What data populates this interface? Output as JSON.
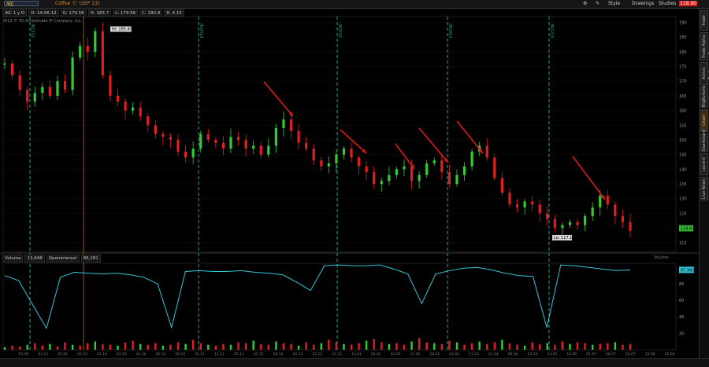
{
  "toolbar": {
    "symbol": "/KC",
    "description": "Coffee 'C' (SEP 13)",
    "style_label": "Style",
    "drawings_label": "Drawings",
    "studies_label": "Studies",
    "price_badge": "118.90"
  },
  "info": {
    "symbol_interval": "/KC 1 y D",
    "date": "D: 14.06.12",
    "open": "O: 179.56",
    "high": "H: 183.7",
    "low": "L: 179.56",
    "close": "C: 180.9",
    "change": "R: 4.15"
  },
  "copyright": "2013 © TD Ameritrade IP Company, Inc.",
  "right_tabs": [
    "Trade",
    "Trade Alpha Scanner",
    "Active Trader",
    "BigButtons",
    "Chart",
    "Dashboard",
    "Level II",
    "Live News"
  ],
  "right_tab_active": "Chart",
  "volume_bar": {
    "volume_label": "Volume",
    "volume_value": "13,648",
    "oi_label": "OpenInterest",
    "oi_value": "86,281",
    "study_label": "Volume·"
  },
  "colors": {
    "up": "#33cc33",
    "down": "#e02020",
    "oi_line": "#33c6d6",
    "annotation": "#dd1a1a",
    "contract_roll": "#1fa890"
  },
  "chart_data": [
    {
      "type": "line",
      "panel": "price",
      "x_dates": [
        "03.09",
        "04.11",
        "05.01",
        "02.02",
        "01.10",
        "03.10",
        "04.10",
        "05.10",
        "28.10",
        "01.11",
        "11.11",
        "25.11",
        "02.12",
        "09.12",
        "16.12",
        "23.12",
        "31.12",
        "14.01",
        "28.01",
        "04.02",
        "11.02",
        "28.02",
        "04.03",
        "11.03",
        "01.04",
        "08.04",
        "22.04",
        "13.05",
        "10.06",
        "01.07",
        "08.07",
        "29.07",
        "12.08",
        "16.08"
      ],
      "y_ticks": [
        115,
        120,
        125,
        130,
        135,
        140,
        145,
        150,
        155,
        160,
        165,
        170,
        175,
        180,
        185,
        190
      ],
      "ylim": [
        112,
        192
      ],
      "series": [
        {
          "values": [
            176,
            172,
            167,
            163,
            166,
            168,
            165,
            170,
            167,
            178,
            182,
            180,
            187,
            172,
            165,
            163,
            160,
            161,
            158,
            155,
            152,
            151,
            150,
            146,
            144,
            147,
            152,
            150,
            149,
            147,
            151,
            150,
            147,
            148,
            145,
            148,
            154,
            157,
            153,
            149,
            147,
            143,
            141,
            142,
            145,
            147,
            144,
            141,
            139,
            135,
            136,
            138,
            140,
            141,
            136,
            138,
            142,
            143,
            139,
            135,
            138,
            141,
            146,
            148,
            144,
            137,
            132,
            128,
            127,
            129,
            128,
            125,
            123,
            120,
            121,
            122,
            121,
            124,
            127,
            131,
            128,
            124,
            122,
            119
          ]
        }
      ],
      "annotations": [
        {
          "type": "hi",
          "text": "Hi: 185.45",
          "value": 185.45
        },
        {
          "type": "lo",
          "text": "Lo: 117.1",
          "value": 117.1
        },
        {
          "type": "price_badge",
          "text": "119.9",
          "value": 119.9
        }
      ],
      "arrows": 7,
      "contract_roll_labels": [
        "/KCZ12",
        "/KCH13",
        "/KCK13",
        "/KCN13",
        "/KCU13"
      ]
    },
    {
      "type": "line",
      "panel": "volume_open_interest",
      "ylim": [
        0,
        105
      ],
      "y_ticks": [
        20,
        40,
        60,
        80
      ],
      "series": [
        {
          "name": "Volume",
          "values": [
            3,
            5,
            4,
            6,
            8,
            5,
            7,
            4,
            9,
            6,
            5,
            8,
            10,
            7,
            6,
            5,
            9,
            11,
            7,
            6,
            8,
            5,
            6,
            9,
            7,
            12,
            8,
            6,
            5,
            7,
            6,
            9,
            8,
            11,
            7,
            6,
            10,
            8,
            7,
            5,
            9,
            6,
            8,
            12,
            9,
            7,
            6,
            8,
            11,
            13,
            9,
            7,
            8,
            6,
            10,
            14,
            9,
            8,
            7,
            11,
            9,
            6,
            8,
            10,
            7,
            9,
            12,
            8,
            6,
            5,
            9,
            7,
            8,
            6,
            10,
            7,
            9,
            8,
            6,
            7,
            8,
            9,
            6,
            7
          ]
        },
        {
          "name": "OpenInterest",
          "values": [
            90,
            84,
            55,
            26,
            88,
            94,
            93,
            92,
            93,
            91,
            88,
            80,
            27,
            95,
            96,
            95,
            95,
            96,
            94,
            93,
            91,
            82,
            72,
            102,
            103,
            102,
            102,
            103,
            98,
            92,
            56,
            92,
            96,
            99,
            100,
            97,
            93,
            90,
            89,
            27,
            103,
            102,
            100,
            98,
            96,
            97
          ]
        }
      ],
      "oi_current": "87,960"
    }
  ]
}
